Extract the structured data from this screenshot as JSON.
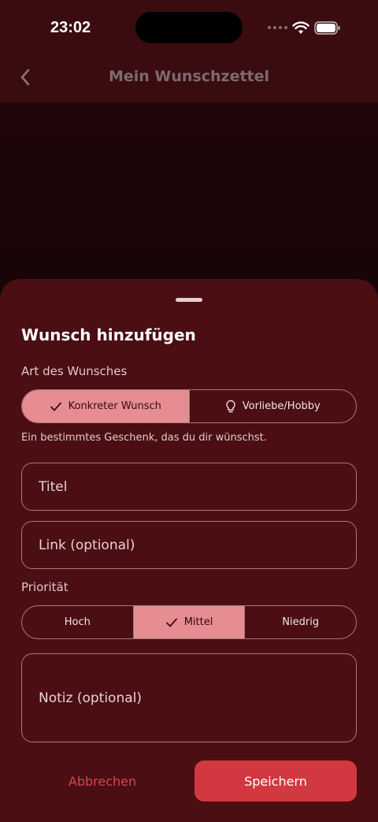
{
  "status_bar": {
    "time": "23:02"
  },
  "app_bar": {
    "title": "Mein Wunschzettel"
  },
  "sheet": {
    "title": "Wunsch hinzufügen",
    "type_section": {
      "label": "Art des Wunsches",
      "options": [
        "Konkreter Wunsch",
        "Vorliebe/Hobby"
      ],
      "selected": "Konkreter Wunsch",
      "hint": "Ein bestimmtes Geschenk, das du dir wünschst."
    },
    "fields": {
      "title_placeholder": "Titel",
      "link_placeholder": "Link (optional)",
      "note_placeholder": "Notiz (optional)"
    },
    "priority_section": {
      "label": "Priorität",
      "options": [
        "Hoch",
        "Mittel",
        "Niedrig"
      ],
      "selected": "Mittel"
    },
    "actions": {
      "cancel": "Abbrechen",
      "save": "Speichern"
    }
  },
  "colors": {
    "sheet_background": "#4a0e13",
    "selected_segment": "#e58d92",
    "primary_button": "#d2383f",
    "cancel_text": "#d6464f"
  },
  "icons": {
    "back": "chevron-left-icon",
    "wifi": "wifi-icon",
    "battery": "battery-icon",
    "check": "check-icon",
    "idea": "lightbulb-icon"
  }
}
